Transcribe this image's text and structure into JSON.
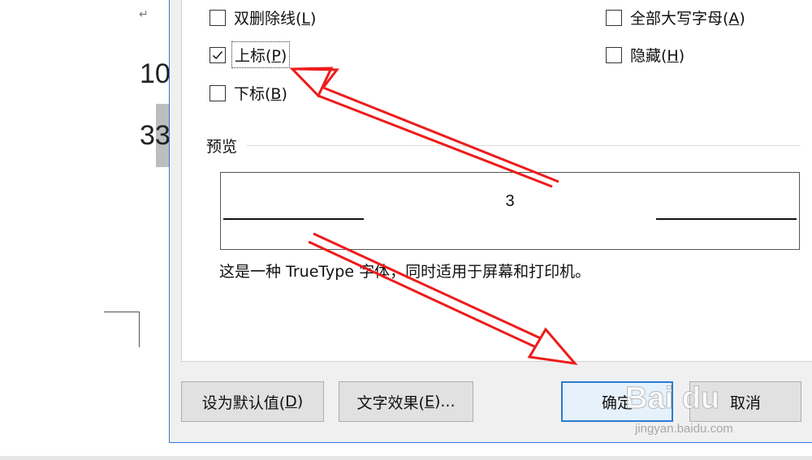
{
  "document": {
    "paragraph_mark": "↵",
    "line1": "10",
    "line2": "33"
  },
  "dialog": {
    "effects": {
      "double_strikethrough": {
        "label": "双删除线(",
        "key": "L",
        "suffix": ")",
        "checked": false
      },
      "superscript": {
        "label": "上标(",
        "key": "P",
        "suffix": ")",
        "checked": true
      },
      "subscript": {
        "label": "下标(",
        "key": "B",
        "suffix": ")",
        "checked": false
      },
      "all_caps": {
        "label": "全部大写字母(",
        "key": "A",
        "suffix": ")",
        "checked": false
      },
      "hidden": {
        "label": "隐藏(",
        "key": "H",
        "suffix": ")",
        "checked": false
      }
    },
    "preview": {
      "title": "预览",
      "sample_text": "3"
    },
    "description": "这是一种 TrueType 字体，同时适用于屏幕和打印机。",
    "buttons": {
      "set_default": {
        "label": "设为默认值(",
        "key": "D",
        "suffix": ")"
      },
      "text_effects": {
        "label": "文字效果(",
        "key": "E",
        "suffix": ")..."
      },
      "ok": "确定",
      "cancel": "取消"
    }
  },
  "watermark": {
    "logo": "Bai du",
    "site": "jingyan.baidu.com"
  },
  "colors": {
    "accent": "#2b7bd1",
    "arrow": "#ee1b1b",
    "dialog_bg": "#f0f0f0"
  }
}
